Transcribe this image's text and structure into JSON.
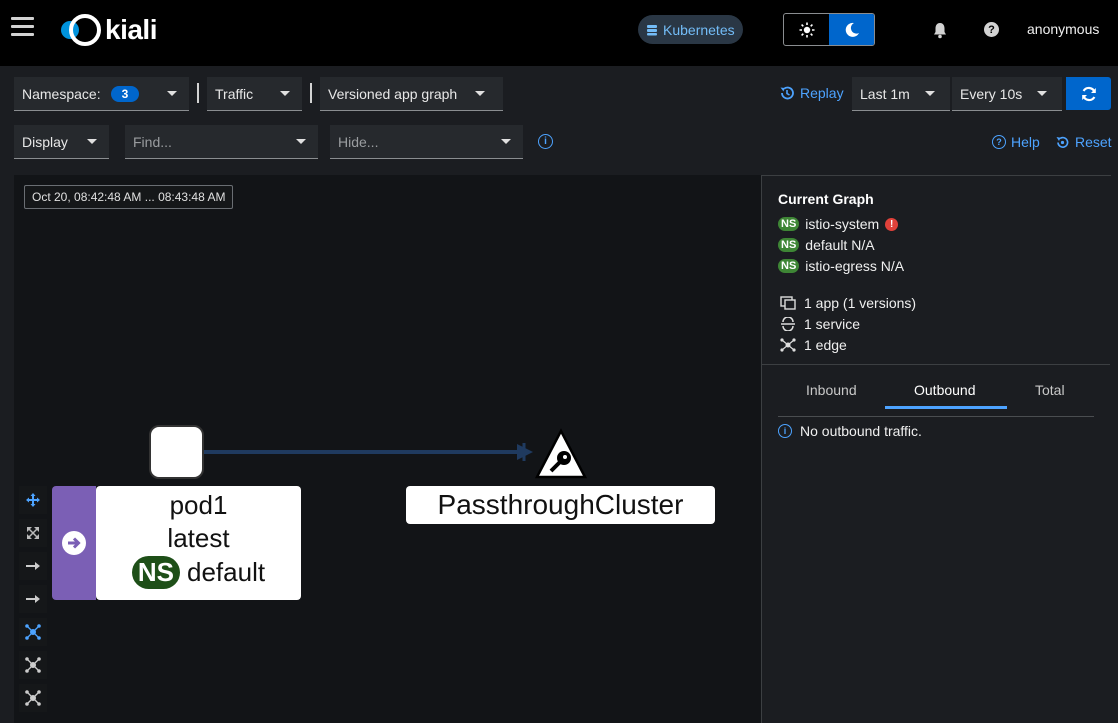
{
  "masthead": {
    "logo_text": "kiali",
    "cluster_label": "Kubernetes",
    "user": "anonymous",
    "colors": {
      "accent": "#0066cc",
      "logo_blue": "#0093dd"
    }
  },
  "toolbar": {
    "namespace_label": "Namespace:",
    "namespace_count": "3",
    "traffic_label": "Traffic",
    "graph_type_label": "Versioned app graph",
    "replay_label": "Replay",
    "duration_label": "Last 1m",
    "refresh_interval_label": "Every 10s",
    "display_label": "Display",
    "find_placeholder": "Find...",
    "hide_placeholder": "Hide...",
    "help_label": "Help",
    "reset_label": "Reset"
  },
  "graph": {
    "timestamp": "Oct 20, 08:42:48 AM ... 08:43:48 AM",
    "source_node": {
      "name": "pod1",
      "version": "latest",
      "ns_badge": "NS",
      "namespace": "default"
    },
    "target_node": {
      "name": "PassthroughCluster"
    }
  },
  "side_panel": {
    "title": "Current Graph",
    "namespaces": [
      {
        "badge": "NS",
        "name": "istio-system",
        "status": "!"
      },
      {
        "badge": "NS",
        "name": "default N/A"
      },
      {
        "badge": "NS",
        "name": "istio-egress N/A"
      }
    ],
    "stats": [
      {
        "icon": "app-icon",
        "text": "1 app (1 versions)"
      },
      {
        "icon": "service-icon",
        "text": "1 service"
      },
      {
        "icon": "topology-icon",
        "text": "1 edge"
      }
    ],
    "tabs": [
      "Inbound",
      "Outbound",
      "Total"
    ],
    "active_tab": "Outbound",
    "message": "No outbound traffic."
  }
}
